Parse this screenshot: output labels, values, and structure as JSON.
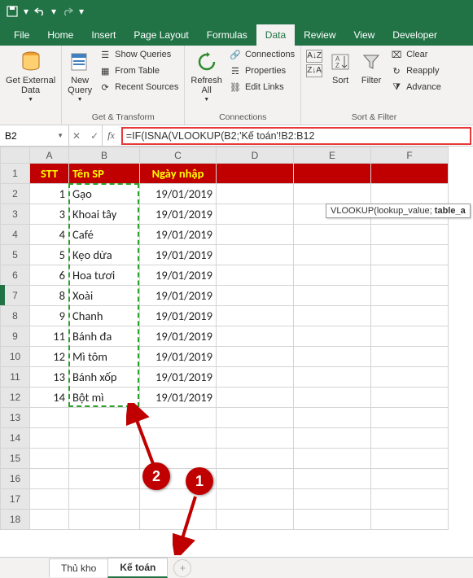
{
  "qat": {
    "save": "save",
    "undo": "undo",
    "redo": "redo"
  },
  "tabs": {
    "file": "File",
    "home": "Home",
    "insert": "Insert",
    "page_layout": "Page Layout",
    "formulas": "Formulas",
    "data": "Data",
    "review": "Review",
    "view": "View",
    "developer": "Developer"
  },
  "ribbon": {
    "get_external": "Get External\nData",
    "g1_label": "",
    "new_query": "New\nQuery",
    "show_queries": "Show Queries",
    "from_table": "From Table",
    "recent_sources": "Recent Sources",
    "g2_label": "Get & Transform",
    "refresh_all": "Refresh\nAll",
    "connections": "Connections",
    "properties": "Properties",
    "edit_links": "Edit Links",
    "g3_label": "Connections",
    "sort": "Sort",
    "filter": "Filter",
    "clear": "Clear",
    "reapply": "Reapply",
    "advanced": "Advance",
    "g4_label": "Sort & Filter"
  },
  "name_box": "B2",
  "formula": "=IF(ISNA(VLOOKUP(B2;'Kế toán'!B2:B12",
  "tooltip": "VLOOKUP(lookup_value; table_a",
  "headers": {
    "stt": "STT",
    "ten_sp": "Tên SP",
    "ngay_nhap": "Ngày nhập"
  },
  "rows": [
    {
      "stt": 1,
      "sp": "Gạo",
      "ngay": "19/01/2019"
    },
    {
      "stt": 3,
      "sp": "Khoai tây",
      "ngay": "19/01/2019"
    },
    {
      "stt": 4,
      "sp": "Café",
      "ngay": "19/01/2019"
    },
    {
      "stt": 5,
      "sp": "Kẹo dừa",
      "ngay": "19/01/2019"
    },
    {
      "stt": 6,
      "sp": "Hoa tươi",
      "ngay": "19/01/2019"
    },
    {
      "stt": 8,
      "sp": "Xoài",
      "ngay": "19/01/2019"
    },
    {
      "stt": 9,
      "sp": "Chanh",
      "ngay": "19/01/2019"
    },
    {
      "stt": 11,
      "sp": "Bánh đa",
      "ngay": "19/01/2019"
    },
    {
      "stt": 12,
      "sp": "Mì tôm",
      "ngay": "19/01/2019"
    },
    {
      "stt": 13,
      "sp": "Bánh xốp",
      "ngay": "19/01/2019"
    },
    {
      "stt": 14,
      "sp": "Bột mì",
      "ngay": "19/01/2019"
    }
  ],
  "sheets": {
    "s1": "Thủ kho",
    "s2": "Kế toán"
  },
  "callouts": {
    "c1": "1",
    "c2": "2"
  },
  "cols": [
    "A",
    "B",
    "C",
    "D",
    "E",
    "F"
  ]
}
